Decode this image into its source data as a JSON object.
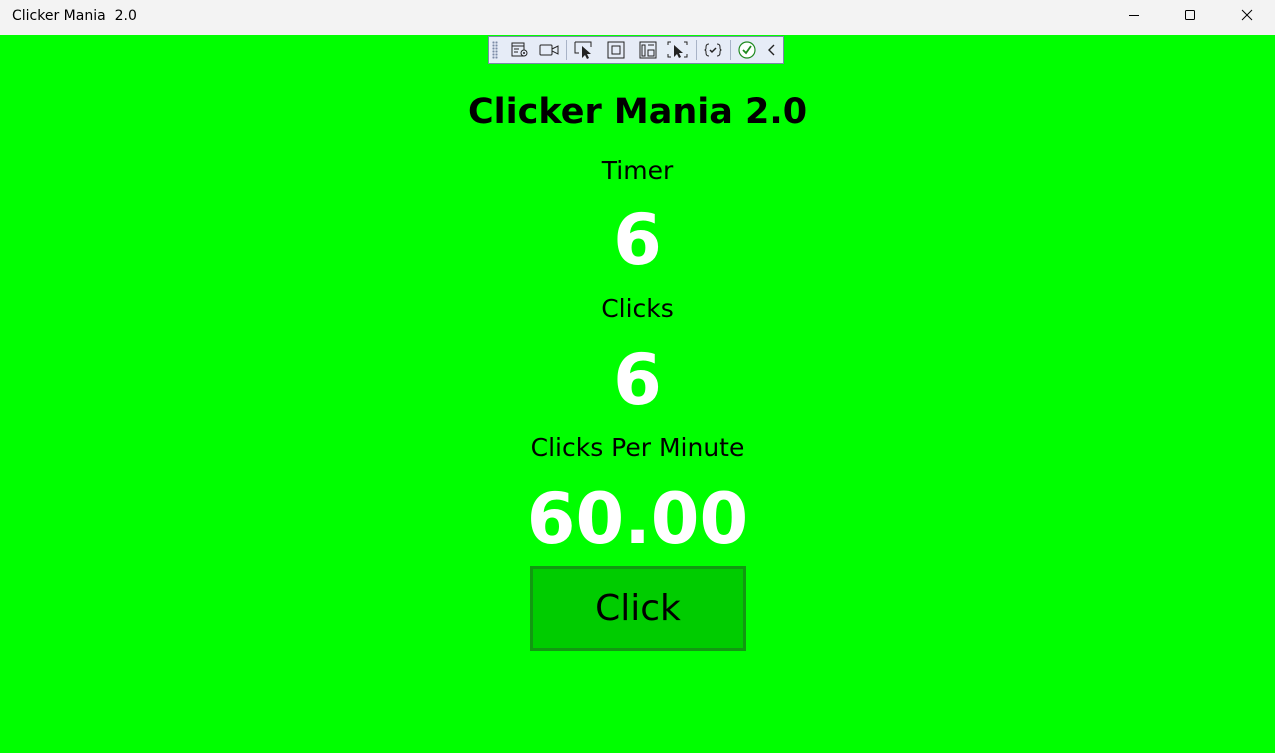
{
  "window": {
    "title": "Clicker Mania  2.0",
    "background_color": "#00ff00",
    "caption_buttons": [
      "minimize-icon",
      "maximize-icon",
      "close-icon"
    ]
  },
  "devtoolbar": {
    "tools": [
      "live-visual-tree-icon",
      "record-icon",
      "select-element-icon",
      "display-layout-adorners-icon",
      "track-focus-icon",
      "preview-selection-icon",
      "binding-failures-icon",
      "accessibility-check-icon",
      "collapse-chevron-icon"
    ]
  },
  "main": {
    "heading": "Clicker Mania 2.0",
    "timer_label": "Timer",
    "timer_value": "6",
    "clicks_label": "Clicks",
    "clicks_value": "6",
    "cpm_label": "Clicks Per Minute",
    "cpm_value": "60.00",
    "click_button_label": "Click",
    "button_color": "#00cc00",
    "value_color": "#ffffff"
  }
}
